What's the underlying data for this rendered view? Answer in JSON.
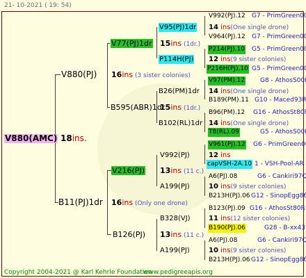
{
  "header": {
    "date": "21- 10-2021 ( 19: 54)"
  },
  "footer": {
    "copyright": "Copyright 2004-2021 @ Karl Kehrle Foundation",
    "site": "www.pedigreeapis.org"
  },
  "root": {
    "name": "V880(AMC)",
    "ins_num": "18",
    "ins_word": "ins."
  },
  "gen1": [
    {
      "id": "g1a",
      "name": "V880(PJ)",
      "ins_num": "16",
      "ins_word": "ins",
      "note": " (3 sister colonies)"
    },
    {
      "id": "g1b",
      "name": "B11(PJ)1dr",
      "ins_num": "16",
      "ins_word": "ins",
      "note": " (Only one drone)"
    }
  ],
  "gen2": [
    {
      "id": "g2a",
      "name": "V77(PJ)1dr",
      "ins_num": "15",
      "ins_word": "ins",
      "note": " (1dr.)"
    },
    {
      "id": "g2b",
      "name": "B595(ABR)1dr",
      "ins_num": "15",
      "ins_word": "ins",
      "note": " (1dr.)"
    },
    {
      "id": "g2c",
      "name": "V216(PJ)",
      "ins_num": "13",
      "ins_word": "ins",
      "note": " (11 c.)"
    },
    {
      "id": "g2d",
      "name": "B126(PJ)",
      "ins_num": "13",
      "ins_word": "ins",
      "note": " (11 c.)"
    }
  ],
  "gen3": [
    {
      "id": "g3a",
      "name": "V95(PJ)1dr",
      "ins_num": "14",
      "ins_word": "ins",
      "note": "(One single drone)"
    },
    {
      "id": "g3b",
      "name": "P114H(PJ)",
      "ins_num": "12",
      "ins_word": "ins",
      "note": "(9 sister colonies)"
    },
    {
      "id": "g3c",
      "name": "B26(PM)1dr",
      "ins_num": "14",
      "ins_word": "ins",
      "note": "(One single drone)"
    },
    {
      "id": "g3d",
      "name": "B102(RL)1dr",
      "ins_num": "14",
      "ins_word": "ins",
      "note": "(One single drone)"
    },
    {
      "id": "g3e",
      "name": "V992(PJ)",
      "ins_num": "12",
      "ins_word": "ins",
      "note": ""
    },
    {
      "id": "g3f",
      "name": "A199(PJ)",
      "ins_num": "10",
      "ins_word": "ins",
      "note": "(9 sister colonies)"
    },
    {
      "id": "g3g",
      "name": "B328(VJ)",
      "ins_num": "11",
      "ins_word": "ins",
      "note": "(12 sister colonies)"
    },
    {
      "id": "g3h",
      "name": "A199(PJ)",
      "ins_num": "10",
      "ins_word": "ins",
      "note": "(9 sister colonies)"
    }
  ],
  "gen4": [
    {
      "name": "V992(PJ).12",
      "group": "G7 - PrimGreen00"
    },
    {
      "name": "V964(PJ).12",
      "group": "G7 - PrimGreen00"
    },
    {
      "name": "P214(PJ).10",
      "group": "G5 - PrimGreen00"
    },
    {
      "name": "P216H(PJ).10",
      "group": "G5 - PrimGreen00"
    },
    {
      "name": "V97(PM).12",
      "group": "G8 - AthosS00R"
    },
    {
      "name": "B189(PM).11",
      "group": "G10 - Maced93R"
    },
    {
      "name": "B96(PM).12",
      "group": "G16 - AthosSt80R"
    },
    {
      "name": "T8(RL).09",
      "group": "G5 - AthosS00R"
    },
    {
      "name": "V961(PJ).12",
      "group": "G6 - PrimGreen00"
    },
    {
      "name": "capVSH-2A.10",
      "group": "1 - VSH-Pool-AR"
    },
    {
      "name": "A6(PJ).08",
      "group": "G6 - Cankiri97Q"
    },
    {
      "name": "B213H(PJ).06",
      "group": "G12 - SinopEgg86R"
    },
    {
      "name": "B123(PJ).09",
      "group": "G16 - AthosSt80R"
    },
    {
      "name": "B190(PJ).06",
      "group": "G28 - B-xx43"
    },
    {
      "name": "A6(PJ).08",
      "group": "G6 - Cankiri97Q"
    },
    {
      "name": "B213H(PJ).06",
      "group": "G12 - SinopEgg86R"
    }
  ],
  "colors": {
    "ins": "#c00000",
    "group": "#2020c0",
    "green": "#22c022",
    "cyan": "#2ee8f0",
    "yellow": "#f4f400",
    "pink": "#f4b4f4"
  }
}
